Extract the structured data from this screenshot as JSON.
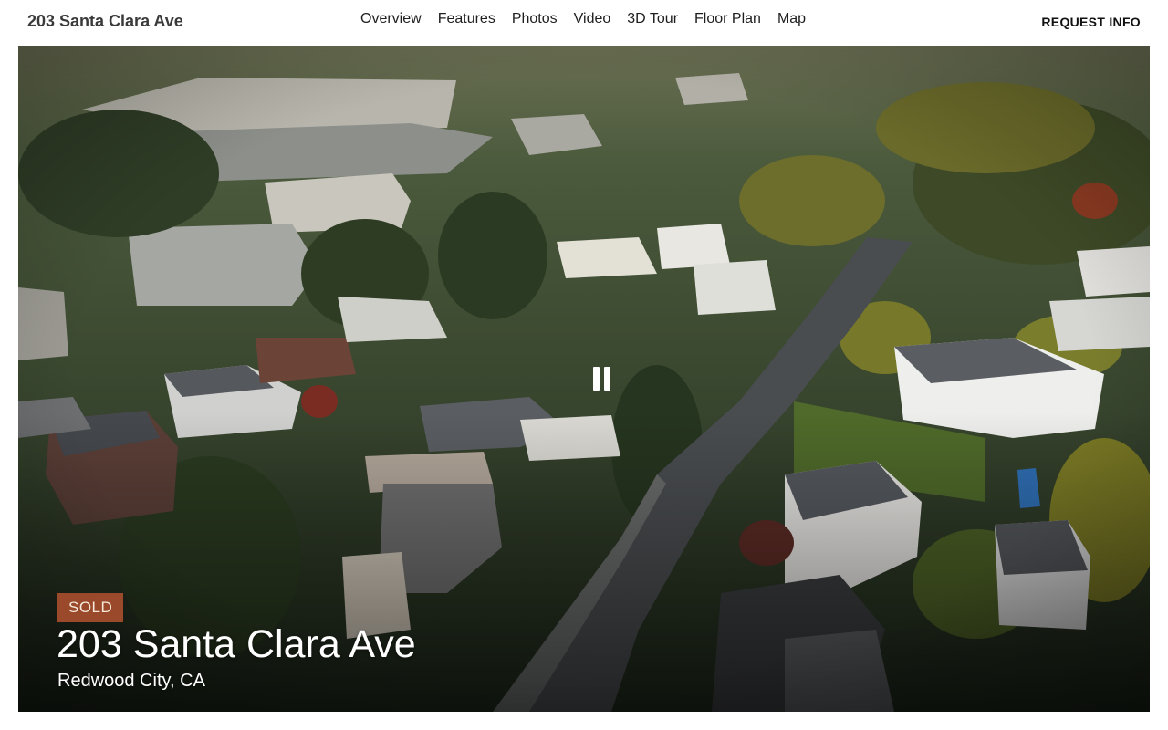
{
  "header": {
    "site_title": "203 Santa Clara Ave",
    "nav": {
      "overview": "Overview",
      "features": "Features",
      "photos": "Photos",
      "video": "Video",
      "tour": "3D Tour",
      "floor_plan": "Floor Plan",
      "map": "Map"
    },
    "request_info": "REQUEST INFO"
  },
  "hero": {
    "status": "SOLD",
    "title": "203 Santa Clara Ave",
    "subtitle": "Redwood City, CA",
    "video_control_icon": "pause-icon"
  },
  "colors": {
    "sold_badge": "#9a4a2a",
    "text_on_hero": "#ffffff"
  }
}
